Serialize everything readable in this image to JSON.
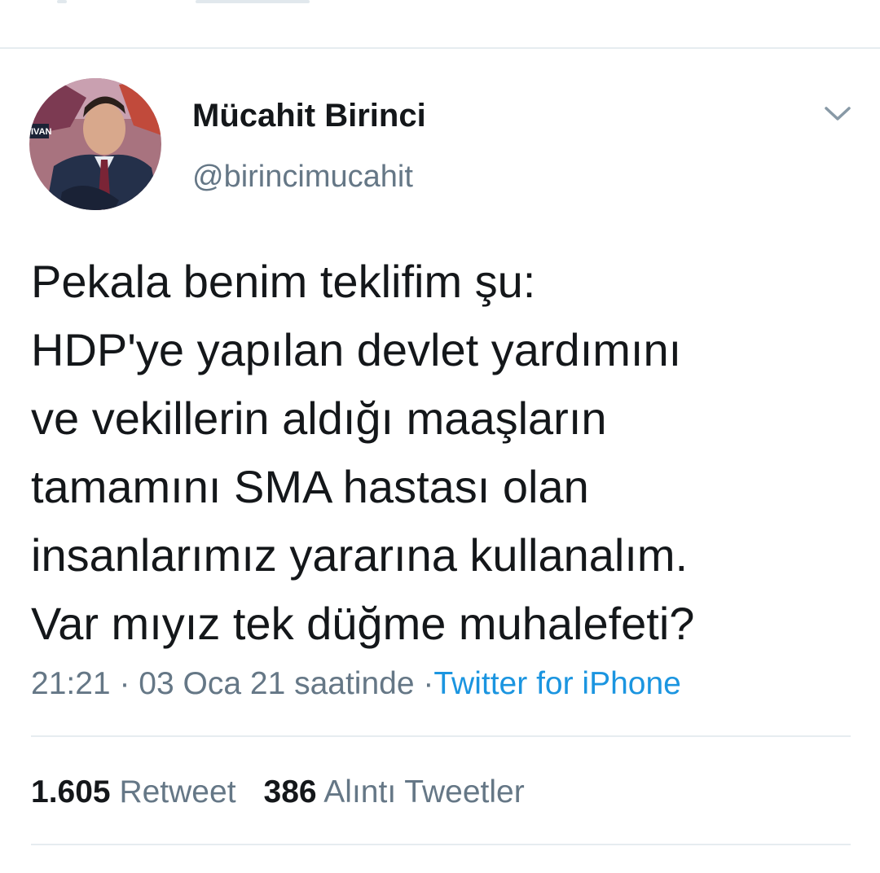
{
  "author": {
    "name": "Mücahit Birinci",
    "handle": "@birincimucahit",
    "avatar_icon": "profile-photo",
    "avatar_overlay_text": "IVAN"
  },
  "tweet": {
    "text_lines": [
      "Pekala benim teklifim şu:",
      "HDP'ye yapılan devlet yardımını",
      "ve vekillerin aldığı maaşların",
      "tamamını SMA hastası olan",
      "insanlarımız yararına kullanalım.",
      "Var mıyız tek düğme muhalefeti?"
    ],
    "time": "21:21",
    "date": "03 Oca 21 saatinde",
    "separator": "·",
    "source": "Twitter for iPhone"
  },
  "stats": {
    "retweets_count": "1.605",
    "retweets_label": "Retweet",
    "quotes_count": "386",
    "quotes_label": "Alıntı Tweetler"
  },
  "icons": {
    "menu": "chevron-down-icon"
  },
  "colors": {
    "text_primary": "#14171a",
    "text_secondary": "#657786",
    "link": "#1b95e0",
    "divider": "#e6ecf0"
  }
}
